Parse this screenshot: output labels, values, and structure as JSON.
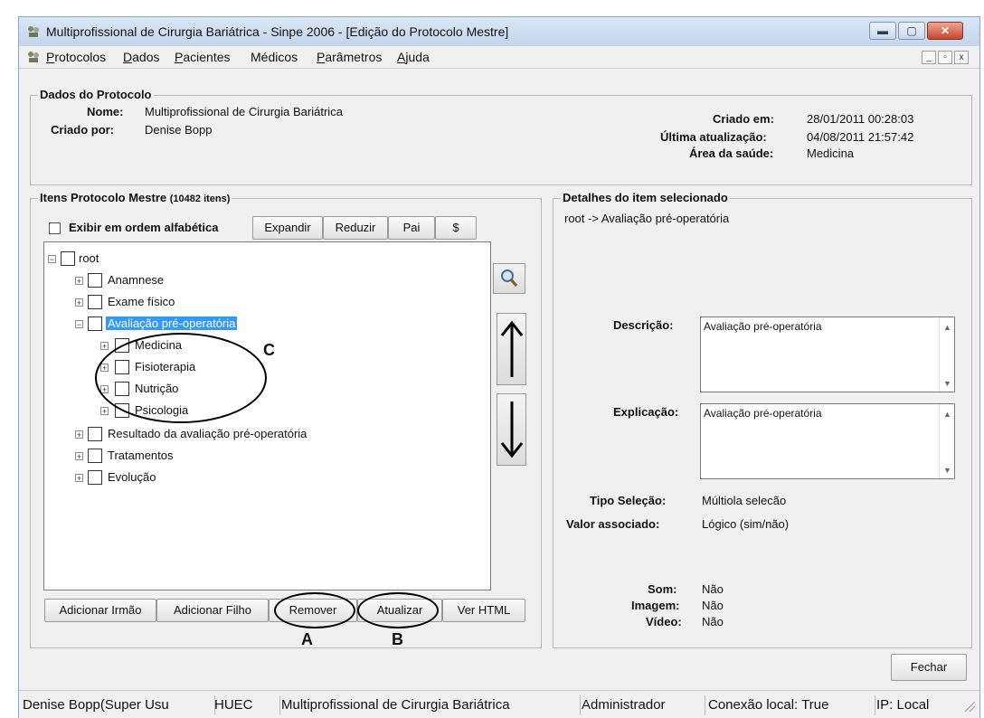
{
  "window": {
    "title": "Multiprofissional de Cirurgia Bariátrica - Sinpe 2006 - [Edição do Protocolo Mestre]"
  },
  "menu": {
    "items": [
      {
        "label": "Protocolos",
        "underline": "P",
        "rest": "rotocolos"
      },
      {
        "label": "Dados",
        "underline": "D",
        "rest": "ados"
      },
      {
        "label": "Pacientes",
        "underline": "P",
        "rest": "acientes"
      },
      {
        "label": "Médicos",
        "underline": "",
        "rest": "Médicos"
      },
      {
        "label": "Parâmetros",
        "underline": "P",
        "rest": "arâmetros"
      },
      {
        "label": "Ajuda",
        "underline": "A",
        "rest": "juda"
      }
    ]
  },
  "protocol": {
    "group_title": "Dados do Protocolo",
    "name_label": "Nome:",
    "name_value": "Multiprofissional de Cirurgia Bariátrica",
    "created_by_label": "Criado por:",
    "created_by_value": "Denise Bopp",
    "created_at_label": "Criado em:",
    "created_at_value": "28/01/2011 00:28:03",
    "updated_label": "Última atualização:",
    "updated_value": "04/08/2011 21:57:42",
    "area_label": "Área da saúde:",
    "area_value": "Medicina"
  },
  "items": {
    "group_title": "Itens Protocolo Mestre",
    "count": "(10482 itens)",
    "alpha_label": "Exibir em ordem alfabética",
    "buttons": {
      "expand": "Expandir",
      "reduce": "Reduzir",
      "parent": "Pai",
      "dollar": "$"
    },
    "tree": {
      "root": "root",
      "anamnese": "Anamnese",
      "exame": "Exame físico",
      "avaliacao": "Avaliação pré-operatória",
      "medicina": "Medicina",
      "fisioterapia": "Fisioterapia",
      "nutricao": "Nutrição",
      "psicologia": "Psicologia",
      "resultado": "Resultado da avaliação pré-operatória",
      "tratamentos": "Tratamentos",
      "evolucao": "Evolução"
    },
    "bottom_buttons": {
      "add_sibling": "Adicionar Irmão",
      "add_child": "Adicionar Filho",
      "remove": "Remover",
      "update": "Atualizar",
      "html": "Ver HTML"
    }
  },
  "details": {
    "group_title": "Detalhes do item selecionado",
    "path": "root -> Avaliação pré-operatória",
    "desc_label": "Descrição:",
    "desc_value": "Avaliação pré-operatória",
    "expl_label": "Explicação:",
    "expl_value": "Avaliação pré-operatória",
    "tipo_label": "Tipo Seleção:",
    "tipo_value": "Múltiola selecão",
    "valor_label": "Valor associado:",
    "valor_value": "Lógico (sim/não)",
    "som_label": "Som:",
    "som_value": "Não",
    "imagem_label": "Imagem:",
    "imagem_value": "Não",
    "video_label": "Vídeo:",
    "video_value": "Não"
  },
  "close_button": "Fechar",
  "annotations": {
    "a": "A",
    "b": "B",
    "c": "C"
  },
  "status": {
    "user": "Denise Bopp(Super Usu",
    "hospital": "HUEC",
    "protocol": "Multiprofissional de Cirurgia Bariátrica",
    "role": "Administrador",
    "connection": "Conexão local: True",
    "ip": "IP: Local"
  },
  "colors": {
    "selection": "#3399ff",
    "title_gradient": "#c3d5ec",
    "close_red": "#c8452b"
  }
}
